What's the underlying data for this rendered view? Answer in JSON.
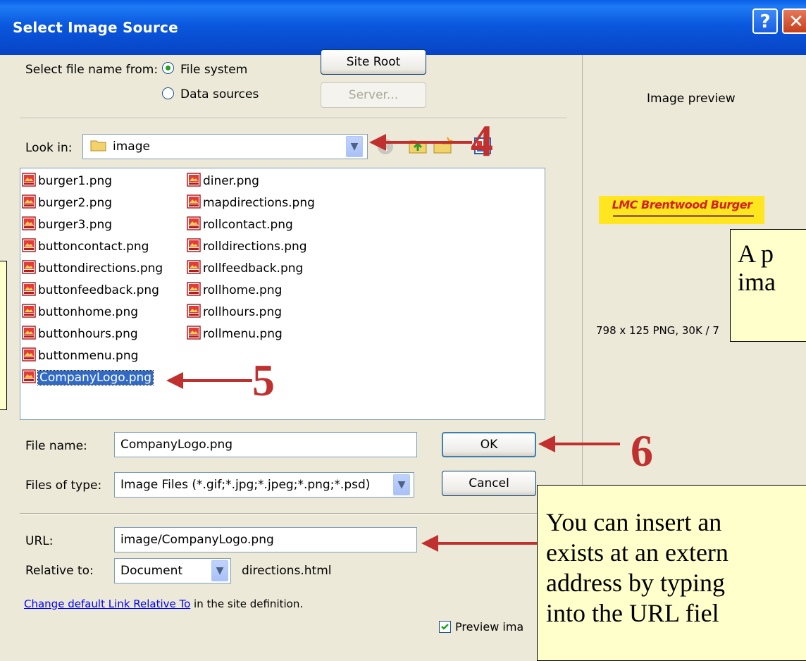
{
  "dialog": {
    "title": "Select Image Source",
    "help_label": "?",
    "close_label": "✕"
  },
  "source": {
    "label": "Select file name from:",
    "option_file_system": "File system",
    "option_data_sources": "Data sources",
    "selected": "File system",
    "site_root_label": "Site Root",
    "server_label": "Server..."
  },
  "look_in": {
    "label": "Look in:",
    "value": "image"
  },
  "files": {
    "column1": [
      "burger1.png",
      "burger2.png",
      "burger3.png",
      "buttoncontact.png",
      "buttondirections.png",
      "buttonfeedback.png",
      "buttonhome.png",
      "buttonhours.png",
      "buttonmenu.png",
      "CompanyLogo.png"
    ],
    "column2": [
      "diner.png",
      "mapdirections.png",
      "rollcontact.png",
      "rolldirections.png",
      "rollfeedback.png",
      "rollhome.png",
      "rollhours.png",
      "rollmenu.png"
    ],
    "selected": "CompanyLogo.png"
  },
  "file_name": {
    "label": "File name:",
    "value": "CompanyLogo.png"
  },
  "files_of_type": {
    "label": "Files of type:",
    "value": "Image Files (*.gif;*.jpg;*.jpeg;*.png;*.psd)"
  },
  "buttons": {
    "ok": "OK",
    "cancel": "Cancel"
  },
  "url": {
    "label": "URL:",
    "value": "image/CompanyLogo.png"
  },
  "relative_to": {
    "label": "Relative to:",
    "value": "Document",
    "file": "directions.html"
  },
  "link_note": {
    "link_text": "Change default Link Relative To",
    "suffix": " in the site definition."
  },
  "preview": {
    "heading": "Image preview",
    "logo_text": "LMC Brentwood Burger",
    "info": "798 x 125 PNG, 30K / 7",
    "checkbox_label": "Preview ima",
    "checkbox_checked": true
  },
  "annotations": {
    "step4": "4",
    "step5": "5",
    "step6": "6",
    "callout_preview_lines": [
      "A p",
      "ima"
    ],
    "callout_url_lines": [
      "You can insert an",
      "exists at an extern",
      "address by typing",
      "into the URL fiel"
    ]
  },
  "colors": {
    "titlebar": "#0A58DE",
    "dialog_bg": "#ECE9D8",
    "callout_bg": "#FFFFCC",
    "annotation_red": "#C0302E",
    "selection": "#316AC5"
  }
}
